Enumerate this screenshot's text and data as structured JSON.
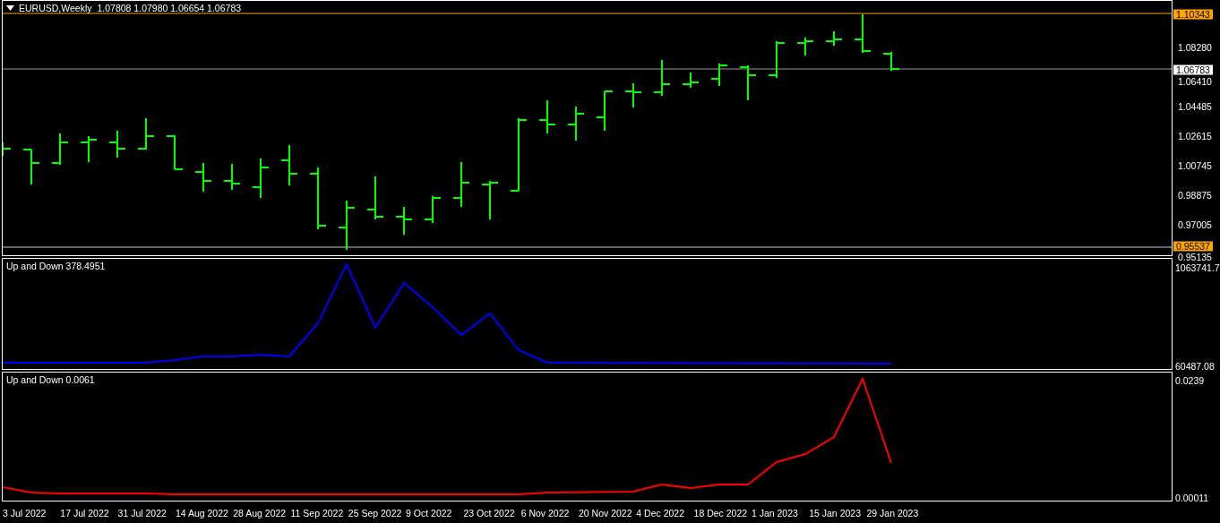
{
  "symbol_bar": {
    "title": "EURUSD,Weekly",
    "ohlc": "1.07808 1.07980 1.06654 1.06783"
  },
  "price_pane": {
    "axis_labels": [
      "1.08280",
      "1.06410",
      "1.04485",
      "1.02615",
      "1.00745",
      "0.98875",
      "0.97005",
      "0.95135"
    ],
    "high_tag": "1.10343",
    "current_tag": "1.06783",
    "low_tag": "0.95537"
  },
  "indicator_panes": [
    {
      "label": "Up and Down 378.4951",
      "color": "#0000ff",
      "axis_labels": [
        "1063741.7",
        "60487.08"
      ]
    },
    {
      "label": "Up and Down 0.0061",
      "color": "#ff0000",
      "axis_labels": [
        "0.0239",
        "0.00011"
      ]
    }
  ],
  "time_axis": [
    "3 Jul 2022",
    "17 Jul 2022",
    "31 Jul 2022",
    "14 Aug 2022",
    "28 Aug 2022",
    "11 Sep 2022",
    "25 Sep 2022",
    "9 Oct 2022",
    "23 Oct 2022",
    "6 Nov 2022",
    "20 Nov 2022",
    "4 Dec 2022",
    "18 Dec 2022",
    "1 Jan 2023",
    "15 Jan 2023",
    "29 Jan 2023"
  ]
}
